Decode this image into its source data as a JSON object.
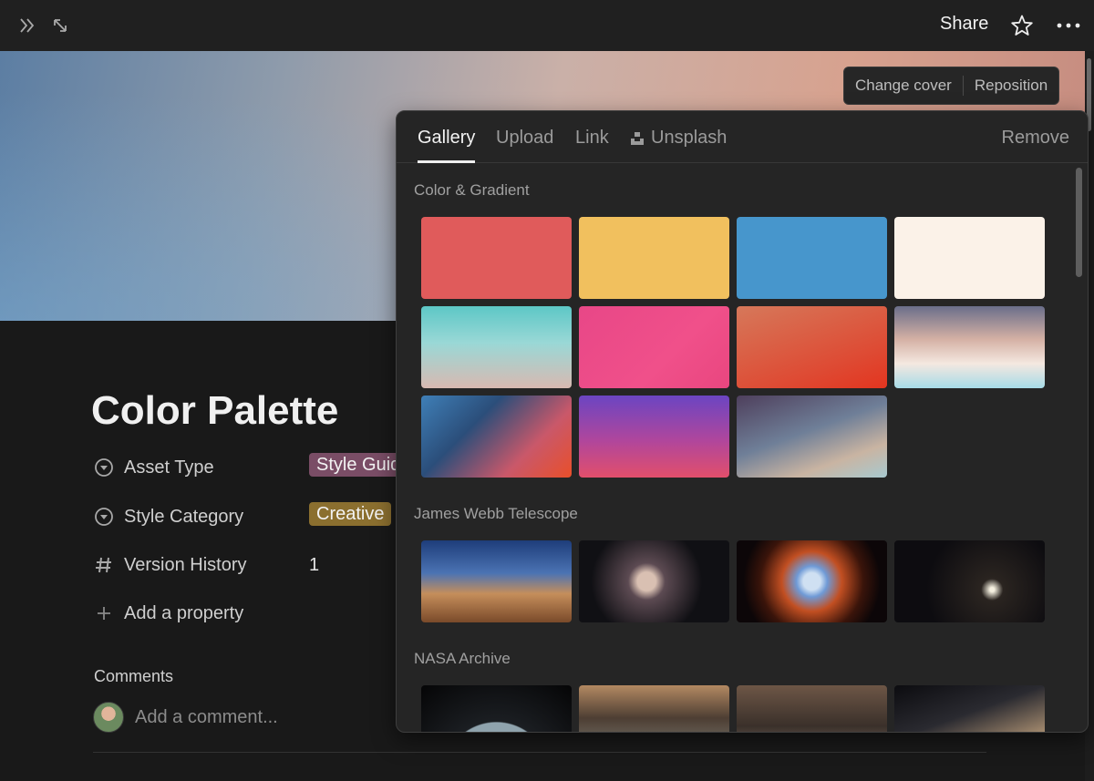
{
  "topbar": {
    "share_label": "Share",
    "icons": [
      "double-chevron-right-icon",
      "expand-arrows-icon",
      "star-icon",
      "more-dots-icon"
    ]
  },
  "cover": {
    "change_cover_label": "Change cover",
    "reposition_label": "Reposition"
  },
  "page": {
    "title": "Color Palette",
    "properties": [
      {
        "label": "Asset Type",
        "value": "Style Guid",
        "icon": "select-circle-icon",
        "tag_color": "#7a4d66"
      },
      {
        "label": "Style Category",
        "value": "Creative",
        "icon": "select-circle-icon",
        "tag_color": "#8b6f2f"
      },
      {
        "label": "Version History",
        "value": "1",
        "icon": "hash-icon"
      }
    ],
    "add_property_label": "Add a property",
    "comments_heading": "Comments",
    "comment_placeholder": "Add a comment..."
  },
  "popup": {
    "tabs": [
      "Gallery",
      "Upload",
      "Link",
      "Unsplash"
    ],
    "active_tab": "Gallery",
    "remove_label": "Remove",
    "sections": [
      {
        "title": "Color & Gradient",
        "items": [
          {
            "name": "solid-red",
            "fill": "#e05b5b"
          },
          {
            "name": "solid-yellow",
            "fill": "#f1c05e"
          },
          {
            "name": "solid-blue",
            "fill": "#4796cc"
          },
          {
            "name": "solid-cream",
            "fill": "#fbf2e8"
          },
          {
            "name": "gradient-teal",
            "fill": "linear-gradient(180deg,#5dc7c6 0%,#9ad8d6 45%,#d8b9b1 100%)"
          },
          {
            "name": "gradient-pink",
            "fill": "linear-gradient(135deg,#e84787 0%,#f0508a 60%,#e9467f 100%)"
          },
          {
            "name": "gradient-orange-red",
            "fill": "linear-gradient(160deg,#d6785a 0%,#de4a33 70%,#e3351f 100%)"
          },
          {
            "name": "gradient-peach-blue",
            "fill": "linear-gradient(180deg,#6a6e8a 0%,#d4b0a4 40%,#f4e8e0 70%,#a7dbe7 100%)"
          },
          {
            "name": "gradient-blue-red",
            "fill": "linear-gradient(135deg,#3f7fb7 0%,#2b4e7a 35%,#c9586a 70%,#e94f2a 100%)"
          },
          {
            "name": "gradient-purple-pink",
            "fill": "linear-gradient(180deg,#6b45c2 0%,#b0469c 55%,#e24f6b 100%)"
          },
          {
            "name": "gradient-dusk",
            "fill": "linear-gradient(160deg,#4e3f5c 0%,#6f7f98 45%,#c9b4a2 75%,#a8c9cf 100%)"
          }
        ]
      },
      {
        "title": "James Webb Telescope",
        "items": [
          {
            "name": "jwst-cosmic-cliffs",
            "fill": "linear-gradient(180deg,#1e3d7a 0%,#4b73b3 40%,#c58e5b 65%,#7a4a2a 100%)"
          },
          {
            "name": "jwst-stephans-quintet",
            "fill": "radial-gradient(circle at 45% 50%,#d9c0b2 0 10%,#5c4a52 20%,#101014 60%)"
          },
          {
            "name": "jwst-southern-ring",
            "fill": "radial-gradient(circle at 50% 50%,#cfe0f2 0 10%,#6f9ad6 18%,#c24f22 35%,#3a140a 60%,#0c0608 80%)"
          },
          {
            "name": "jwst-deep-field",
            "fill": "radial-gradient(circle at 65% 60%,#f5f0e0 0 2%,#2a2420 10%,#0d0c10 60%)"
          }
        ]
      },
      {
        "title": "NASA Archive",
        "items": [
          {
            "name": "nasa-earth",
            "fill": "radial-gradient(circle at 50% 110%,#8fa3ad 0 45%,#1b1e22 46%,#050506 100%)"
          },
          {
            "name": "nasa-rocket-stage",
            "fill": "linear-gradient(180deg,#b38962 0%,#4d3e33 40%,#8a8d86 100%)"
          },
          {
            "name": "nasa-engineers",
            "fill": "linear-gradient(180deg,#6d5646 0%,#3a302a 50%,#9a8676 100%)"
          },
          {
            "name": "nasa-spacewalk",
            "fill": "linear-gradient(160deg,#0c0c10 0%,#2a2a30 40%,#b89a78 80%,#e6d4b8 100%)"
          }
        ]
      }
    ]
  }
}
